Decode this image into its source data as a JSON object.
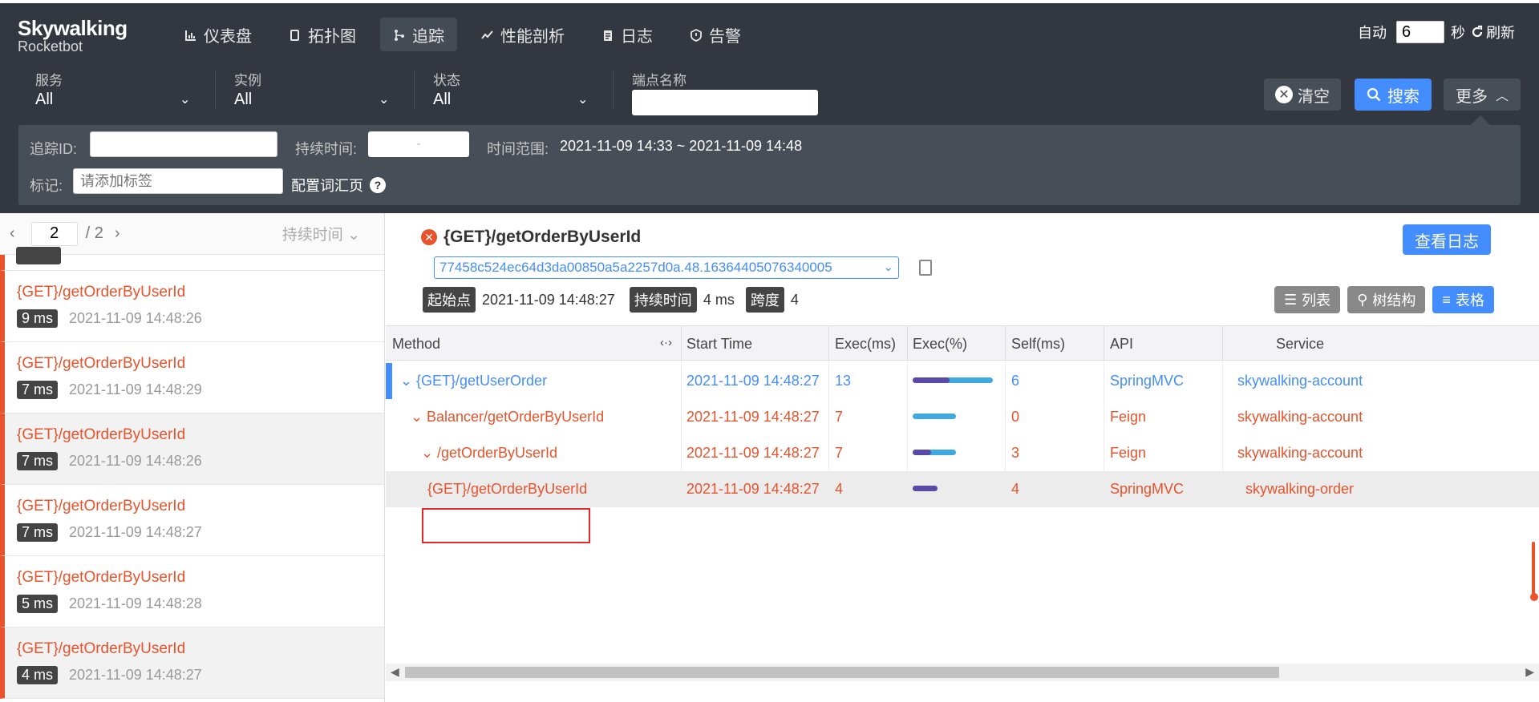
{
  "brand": {
    "name": "Skywalking",
    "sub": "Rocketbot"
  },
  "nav": [
    {
      "label": "仪表盘",
      "icon": "bar-chart-icon",
      "active": false
    },
    {
      "label": "拓扑图",
      "icon": "topology-icon",
      "active": false
    },
    {
      "label": "追踪",
      "icon": "trace-icon",
      "active": true
    },
    {
      "label": "性能剖析",
      "icon": "profile-icon",
      "active": false
    },
    {
      "label": "日志",
      "icon": "log-icon",
      "active": false
    },
    {
      "label": "告警",
      "icon": "alarm-icon",
      "active": false
    }
  ],
  "top_right": {
    "auto_label": "自动",
    "interval": "6",
    "unit": "秒",
    "refresh_label": "刷新"
  },
  "filters": {
    "service": {
      "label": "服务",
      "value": "All"
    },
    "instance": {
      "label": "实例",
      "value": "All"
    },
    "status": {
      "label": "状态",
      "value": "All"
    },
    "endpoint": {
      "label": "端点名称",
      "value": ""
    },
    "clear_label": "清空",
    "search_label": "搜索",
    "more_label": "更多"
  },
  "advanced": {
    "trace_id_label": "追踪ID:",
    "duration_label": "持续时间:",
    "duration_sep": "-",
    "time_range_label": "时间范围:",
    "time_range": "2021-11-09 14:33 ~ 2021-11-09 14:48",
    "tags_label": "标记:",
    "tags_placeholder": "请添加标签",
    "vocab_label": "配置词汇页",
    "help_glyph": "?"
  },
  "pager": {
    "current": "2",
    "total": "/ 2",
    "sort_label": "持续时间"
  },
  "trace_list": [
    {
      "name": "{GET}/getOrderByUserId",
      "duration": "9 ms",
      "time": "2021-11-09 14:48:26",
      "highlight": false
    },
    {
      "name": "{GET}/getOrderByUserId",
      "duration": "7 ms",
      "time": "2021-11-09 14:48:29",
      "highlight": false
    },
    {
      "name": "{GET}/getOrderByUserId",
      "duration": "7 ms",
      "time": "2021-11-09 14:48:26",
      "highlight": true
    },
    {
      "name": "{GET}/getOrderByUserId",
      "duration": "7 ms",
      "time": "2021-11-09 14:48:27",
      "highlight": false
    },
    {
      "name": "{GET}/getOrderByUserId",
      "duration": "5 ms",
      "time": "2021-11-09 14:48:28",
      "highlight": false
    },
    {
      "name": "{GET}/getOrderByUserId",
      "duration": "4 ms",
      "time": "2021-11-09 14:48:27",
      "highlight": true
    }
  ],
  "detail": {
    "title": "{GET}/getOrderByUserId",
    "view_log_label": "查看日志",
    "trace_id": "77458c524ec64d3da00850a5a2257d0a.48.16364405076340005",
    "start_label": "起始点",
    "start_value": "2021-11-09 14:48:27",
    "duration_label": "持续时间",
    "duration_value": "4 ms",
    "span_label": "跨度",
    "span_value": "4",
    "views": [
      {
        "label": "列表",
        "icon": "list-icon",
        "active": false
      },
      {
        "label": "树结构",
        "icon": "tree-icon",
        "active": false
      },
      {
        "label": "表格",
        "icon": "table-icon",
        "active": true
      }
    ]
  },
  "table": {
    "columns": [
      "Method",
      "Start Time",
      "Exec(ms)",
      "Exec(%)",
      "Self(ms)",
      "API",
      "Service"
    ],
    "rows": [
      {
        "method": "{GET}/getUserOrder",
        "start": "2021-11-09 14:48:27",
        "exec": "13",
        "exec_pct": 1.0,
        "self_pct": 0.46,
        "self": "6",
        "api": "SpringMVC",
        "service": "skywalking-account",
        "color": "#448dfe",
        "indent": 0
      },
      {
        "method": "Balancer/getOrderByUserId",
        "start": "2021-11-09 14:48:27",
        "exec": "7",
        "exec_pct": 0.54,
        "self_pct": 0.0,
        "self": "0",
        "api": "Feign",
        "service": "skywalking-account",
        "color": "#e8532c",
        "indent": 1
      },
      {
        "method": "/getOrderByUserId",
        "start": "2021-11-09 14:48:27",
        "exec": "7",
        "exec_pct": 0.54,
        "self_pct": 0.23,
        "self": "3",
        "api": "Feign",
        "service": "skywalking-account",
        "color": "#e8532c",
        "indent": 2
      },
      {
        "method": "{GET}/getOrderByUserId",
        "start": "2021-11-09 14:48:27",
        "exec": "4",
        "exec_pct": 0.31,
        "self_pct": 0.31,
        "self": "4",
        "api": "SpringMVC",
        "service": "skywalking-order",
        "color": "#e8532c",
        "indent": 3
      }
    ]
  }
}
